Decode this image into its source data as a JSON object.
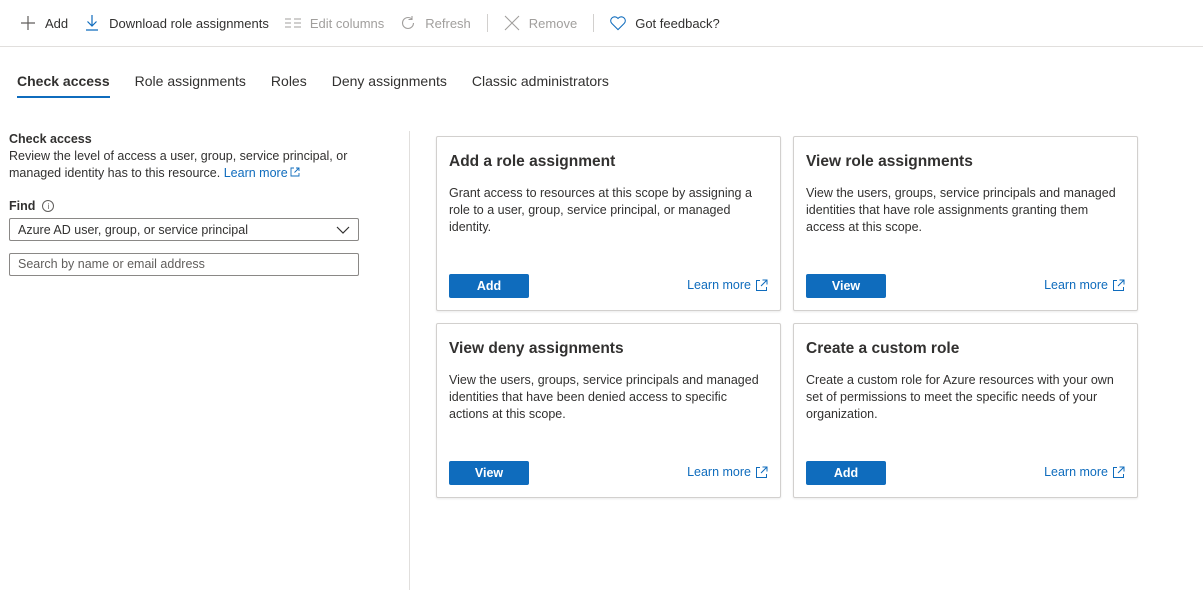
{
  "toolbar": {
    "add": "Add",
    "download": "Download role assignments",
    "edit_columns": "Edit columns",
    "refresh": "Refresh",
    "remove": "Remove",
    "feedback": "Got feedback?"
  },
  "tabs": [
    {
      "label": "Check access",
      "active": true
    },
    {
      "label": "Role assignments"
    },
    {
      "label": "Roles"
    },
    {
      "label": "Deny assignments"
    },
    {
      "label": "Classic administrators"
    }
  ],
  "check_access": {
    "title": "Check access",
    "description": "Review the level of access a user, group, service principal, or managed identity has to this resource.",
    "learn_more": "Learn more",
    "find_label": "Find",
    "find_select_value": "Azure AD user, group, or service principal",
    "search_placeholder": "Search by name or email address"
  },
  "cards": [
    {
      "title": "Add a role assignment",
      "description": "Grant access to resources at this scope by assigning a role to a user, group, service principal, or managed identity.",
      "button": "Add",
      "learn_more": "Learn more"
    },
    {
      "title": "View role assignments",
      "description": "View the users, groups, service principals and managed identities that have role assignments granting them access at this scope.",
      "button": "View",
      "learn_more": "Learn more"
    },
    {
      "title": "View deny assignments",
      "description": "View the users, groups, service principals and managed identities that have been denied access to specific actions at this scope.",
      "button": "View",
      "learn_more": "Learn more"
    },
    {
      "title": "Create a custom role",
      "description": "Create a custom role for Azure resources with your own set of permissions to meet the specific needs of your organization.",
      "button": "Add",
      "learn_more": "Learn more"
    }
  ],
  "colors": {
    "accent": "#0f6cbd",
    "text": "#323130",
    "disabled": "#a19f9d",
    "border": "#d2d0ce"
  }
}
